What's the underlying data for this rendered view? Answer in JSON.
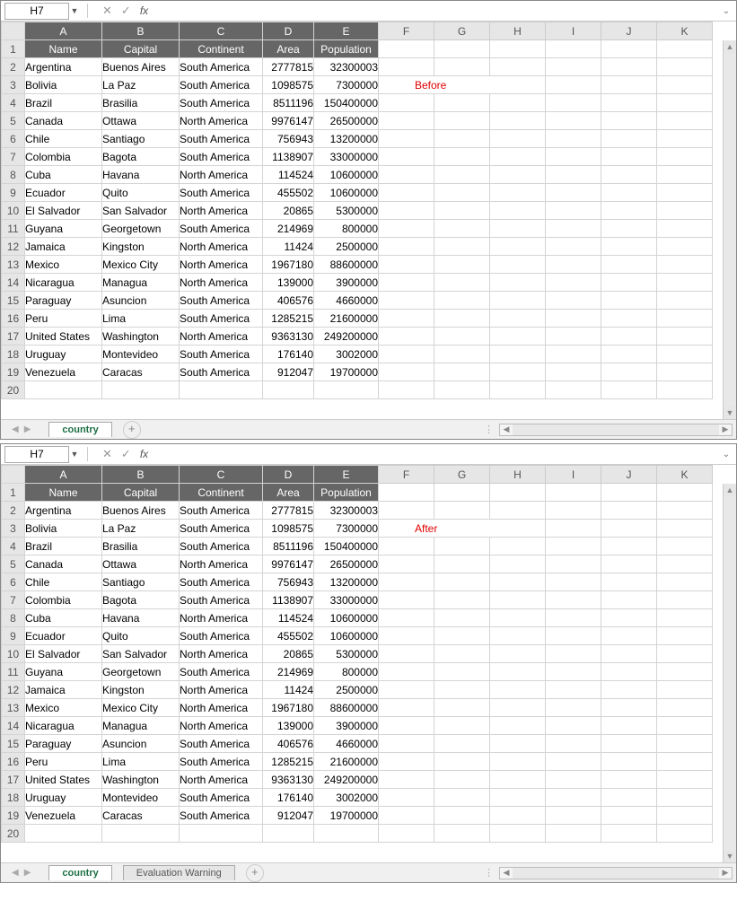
{
  "namebox": "H7",
  "fx": "fx",
  "col_letters": [
    "A",
    "B",
    "C",
    "D",
    "E",
    "F",
    "G",
    "H",
    "I",
    "J",
    "K"
  ],
  "headers": [
    "Name",
    "Capital",
    "Continent",
    "Area",
    "Population"
  ],
  "rows": [
    {
      "n": "Argentina",
      "cap": "Buenos Aires",
      "cont": "South America",
      "area": "2777815",
      "pop": "32300003"
    },
    {
      "n": "Bolivia",
      "cap": "La Paz",
      "cont": "South America",
      "area": "1098575",
      "pop": "7300000"
    },
    {
      "n": "Brazil",
      "cap": "Brasilia",
      "cont": "South America",
      "area": "8511196",
      "pop": "150400000"
    },
    {
      "n": "Canada",
      "cap": "Ottawa",
      "cont": "North America",
      "area": "9976147",
      "pop": "26500000"
    },
    {
      "n": "Chile",
      "cap": "Santiago",
      "cont": "South America",
      "area": "756943",
      "pop": "13200000"
    },
    {
      "n": "Colombia",
      "cap": "Bagota",
      "cont": "South America",
      "area": "1138907",
      "pop": "33000000"
    },
    {
      "n": "Cuba",
      "cap": "Havana",
      "cont": "North America",
      "area": "114524",
      "pop": "10600000"
    },
    {
      "n": "Ecuador",
      "cap": "Quito",
      "cont": "South America",
      "area": "455502",
      "pop": "10600000"
    },
    {
      "n": "El Salvador",
      "cap": "San Salvador",
      "cont": "North America",
      "area": "20865",
      "pop": "5300000"
    },
    {
      "n": "Guyana",
      "cap": "Georgetown",
      "cont": "South America",
      "area": "214969",
      "pop": "800000"
    },
    {
      "n": "Jamaica",
      "cap": "Kingston",
      "cont": "North America",
      "area": "11424",
      "pop": "2500000"
    },
    {
      "n": "Mexico",
      "cap": "Mexico City",
      "cont": "North America",
      "area": "1967180",
      "pop": "88600000"
    },
    {
      "n": "Nicaragua",
      "cap": "Managua",
      "cont": "North America",
      "area": "139000",
      "pop": "3900000"
    },
    {
      "n": "Paraguay",
      "cap": "Asuncion",
      "cont": "South America",
      "area": "406576",
      "pop": "4660000"
    },
    {
      "n": "Peru",
      "cap": "Lima",
      "cont": "South America",
      "area": "1285215",
      "pop": "21600000"
    },
    {
      "n": "United States",
      "cap": "Washington",
      "cont": "North America",
      "area": "9363130",
      "pop": "249200000"
    },
    {
      "n": "Uruguay",
      "cap": "Montevideo",
      "cont": "South America",
      "area": "176140",
      "pop": "3002000"
    },
    {
      "n": "Venezuela",
      "cap": "Caracas",
      "cont": "South America",
      "area": "912047",
      "pop": "19700000"
    }
  ],
  "annotation_before": "Before",
  "annotation_after": "After",
  "tabs_before": [
    "country"
  ],
  "tabs_after": [
    "country",
    "Evaluation Warning"
  ],
  "chart_data": {
    "type": "table",
    "title": "Countries",
    "columns": [
      "Name",
      "Capital",
      "Continent",
      "Area",
      "Population"
    ],
    "rows": [
      [
        "Argentina",
        "Buenos Aires",
        "South America",
        2777815,
        32300003
      ],
      [
        "Bolivia",
        "La Paz",
        "South America",
        1098575,
        7300000
      ],
      [
        "Brazil",
        "Brasilia",
        "South America",
        8511196,
        150400000
      ],
      [
        "Canada",
        "Ottawa",
        "North America",
        9976147,
        26500000
      ],
      [
        "Chile",
        "Santiago",
        "South America",
        756943,
        13200000
      ],
      [
        "Colombia",
        "Bagota",
        "South America",
        1138907,
        33000000
      ],
      [
        "Cuba",
        "Havana",
        "North America",
        114524,
        10600000
      ],
      [
        "Ecuador",
        "Quito",
        "South America",
        455502,
        10600000
      ],
      [
        "El Salvador",
        "San Salvador",
        "North America",
        20865,
        5300000
      ],
      [
        "Guyana",
        "Georgetown",
        "South America",
        214969,
        800000
      ],
      [
        "Jamaica",
        "Kingston",
        "North America",
        11424,
        2500000
      ],
      [
        "Mexico",
        "Mexico City",
        "North America",
        1967180,
        88600000
      ],
      [
        "Nicaragua",
        "Managua",
        "North America",
        139000,
        3900000
      ],
      [
        "Paraguay",
        "Asuncion",
        "South America",
        406576,
        4660000
      ],
      [
        "Peru",
        "Lima",
        "South America",
        1285215,
        21600000
      ],
      [
        "United States",
        "Washington",
        "North America",
        9363130,
        249200000
      ],
      [
        "Uruguay",
        "Montevideo",
        "South America",
        176140,
        3002000
      ],
      [
        "Venezuela",
        "Caracas",
        "South America",
        912047,
        19700000
      ]
    ]
  }
}
